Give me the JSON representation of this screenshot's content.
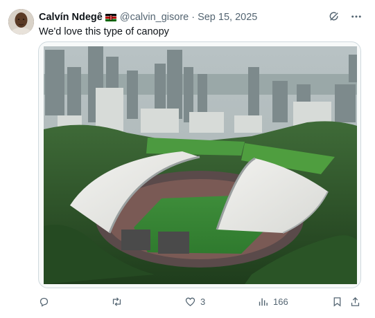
{
  "tweet": {
    "author_name": "Calvín Ndegê",
    "author_handle": "@calvin_gisore",
    "separator": "·",
    "date": "Sep 15, 2025",
    "text": "We'd love this type of canopy",
    "flag": "kenya-flag-emoji",
    "media_alt": "stadium-with-white-canopy-photo"
  },
  "actions": {
    "reply_count": "",
    "retweet_count": "",
    "like_count": "3",
    "views_count": "166"
  },
  "icons": {
    "grok": "grok-icon",
    "more": "more-icon",
    "reply": "reply-icon",
    "retweet": "retweet-icon",
    "like": "heart-icon",
    "views": "views-icon",
    "bookmark": "bookmark-icon",
    "share": "share-icon"
  },
  "colors": {
    "text_primary": "#0f1419",
    "text_secondary": "#536471",
    "border": "#cfd9de"
  }
}
